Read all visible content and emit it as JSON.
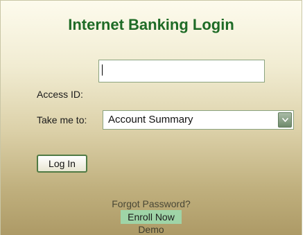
{
  "login": {
    "title": "Internet Banking Login",
    "access_id_label": "Access ID:",
    "access_id_value": "",
    "take_me_to_label": "Take me to:",
    "take_me_to_selected": "Account Summary",
    "login_button": "Log In",
    "forgot_password": "Forgot Password?",
    "enroll_now": "Enroll Now",
    "demo": "Demo"
  },
  "colors": {
    "title": "#1e6b26",
    "enroll_highlight": "#9fd4a7",
    "button_border": "#4f7a44"
  },
  "icons": {
    "dropdown": "chevron-down-icon"
  }
}
